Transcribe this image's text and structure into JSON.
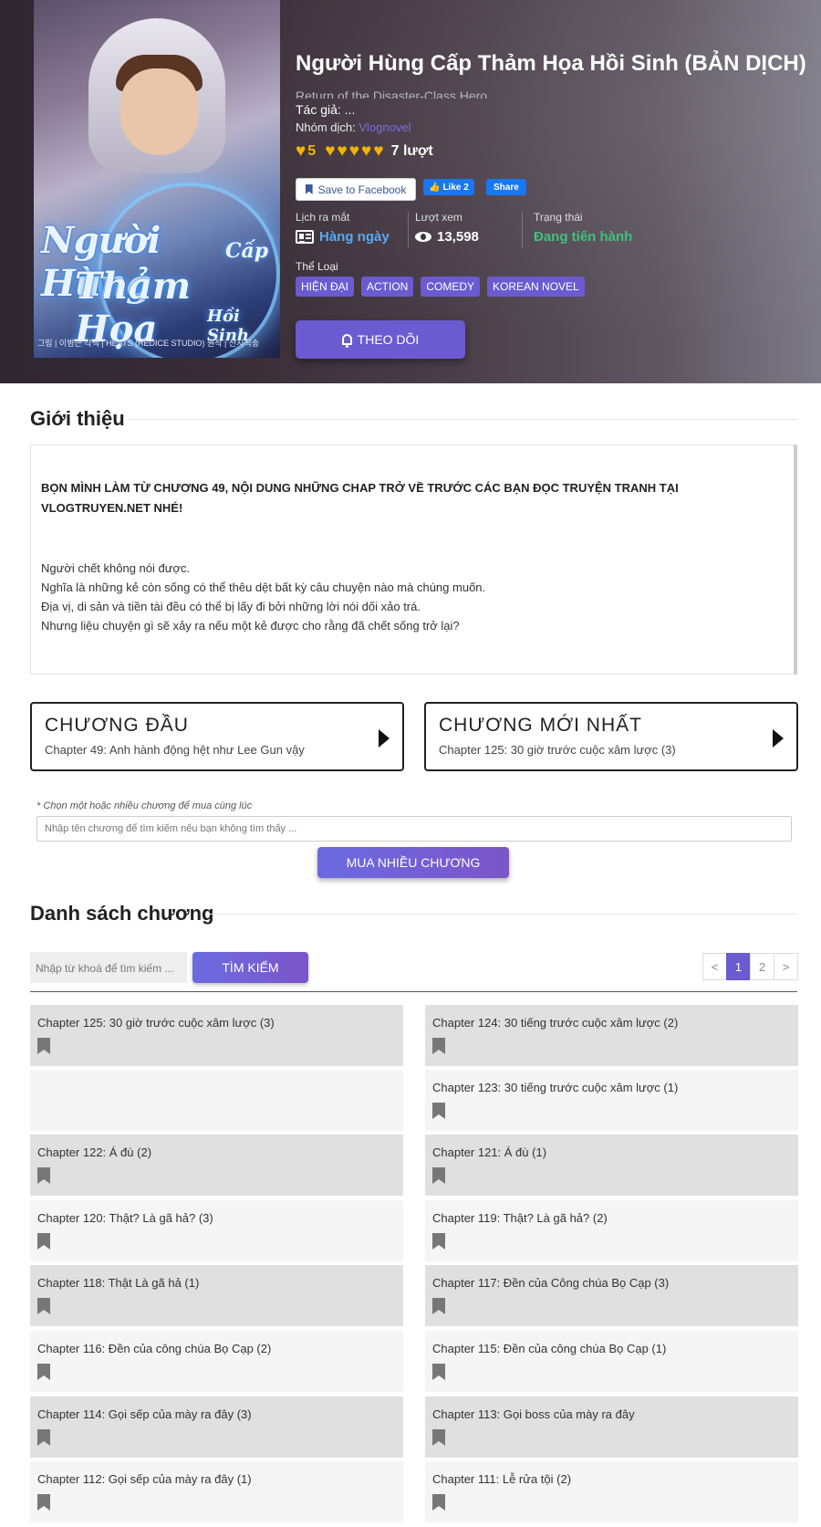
{
  "manga": {
    "title": "Người Hùng Cấp Thảm Họa Hồi Sinh (BẢN DỊCH)",
    "alt_title": "Return of the Disaster-Class Hero",
    "author_label": "Tác giả:",
    "author_value": "...",
    "group_label": "Nhóm dịch:",
    "group_value": "Vlognovel",
    "rating_value": "5",
    "rating_count": "7 lượt",
    "cover": {
      "title_line1": "Người Hùng",
      "title_line1b": "Cấp",
      "title_line2": "Thảm Họa",
      "title_line3": "Hồi Sinh",
      "credit": "그림 | 이범근   각색 | HEATS (REDICE STUDIO)   원작 | 산지직송"
    }
  },
  "social": {
    "save_fb": "Save to Facebook",
    "like": "Like 2",
    "share": "Share"
  },
  "stats": {
    "release_label": "Lịch ra mắt",
    "release_value": "Hàng ngày",
    "views_label": "Lượt xem",
    "views_value": "13,598",
    "status_label": "Trạng thái",
    "status_value": "Đang tiến hành"
  },
  "genres_label": "Thể Loại",
  "genres": [
    "HIỆN ĐẠI",
    "ACTION",
    "COMEDY",
    "KOREAN NOVEL"
  ],
  "follow_label": "THEO DÕI",
  "intro": {
    "heading": "Giới thiệu",
    "notice": "BỌN MÌNH LÀM TỪ CHƯƠNG 49, NỘI DUNG NHỮNG CHAP TRỞ VỀ TRƯỚC CÁC BẠN ĐỌC TRUYỆN TRANH TẠI VLOGTRUYEN.NET NHÉ!",
    "lines": [
      "Người chết không nói được.",
      "Nghĩa là những kẻ còn sống có thể thêu dệt bất kỳ câu chuyện nào mà chúng muốn.",
      "Địa vị, di sản và tiền tài đều có thể bị lấy đi bởi những lời nói dối xảo trá.",
      "Nhưng liệu chuyện gì sẽ xảy ra nếu một kẻ được cho rằng đã chết sống trở lại?"
    ]
  },
  "first_chapter": {
    "heading": "CHƯƠNG ĐẦU",
    "title": "Chapter 49: Anh hành động hệt như Lee Gun vậy"
  },
  "latest_chapter": {
    "heading": "CHƯƠNG MỚI NHẤT",
    "title": "Chapter 125: 30 giờ trước cuộc xâm lược (3)"
  },
  "buy": {
    "note": "* Chọn một hoặc nhiều chương để mua cùng lúc",
    "placeholder": "Nhập tên chương để tìm kiếm nếu bạn không tìm thấy ...",
    "button": "MUA NHIỀU CHƯƠNG"
  },
  "chapter_list": {
    "heading": "Danh sách chương",
    "search_placeholder": "Nhập từ khoá để tìm kiếm ...",
    "search_button": "TÌM KIẾM",
    "pager": {
      "prev": "<",
      "pages": [
        "1",
        "2"
      ],
      "next": ">"
    },
    "items": [
      "Chapter 125: 30 giờ trước cuộc xâm lược (3)",
      "Chapter 124: 30 tiếng trước cuộc xâm lược (2)",
      "",
      "Chapter 123: 30 tiếng trước cuộc xâm lược (1)",
      "Chapter 122: Á đù (2)",
      "Chapter 121: Á đù (1)",
      "Chapter 120: Thật? Là gã hả? (3)",
      "Chapter 119: Thật? Là gã hả? (2)",
      "Chapter 118: Thật Là gã hả (1)",
      "Chapter 117: Đền của Công chúa Bọ Cạp (3)",
      "Chapter 116: Đền của công chúa Bọ Cạp (2)",
      "Chapter 115: Đền của công chúa Bọ Cạp (1)",
      "Chapter 114: Gọi sếp của mày ra đây (3)",
      "Chapter 113: Gọi boss của mày ra đây",
      "Chapter 112: Gọi sếp của mày ra đây (1)",
      "Chapter 111: Lễ rửa tội (2)"
    ]
  }
}
